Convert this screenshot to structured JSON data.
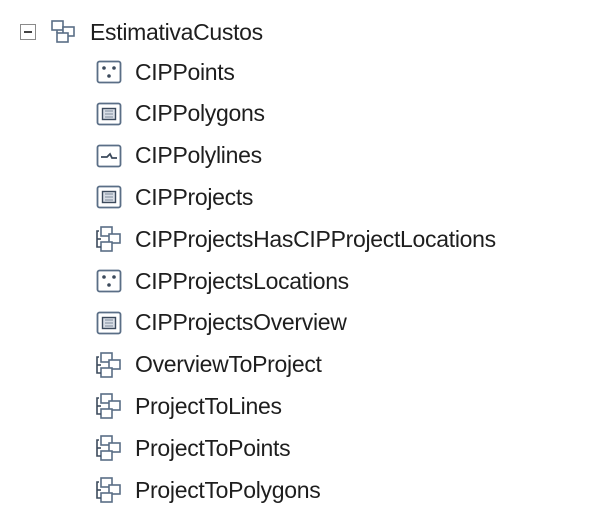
{
  "tree": {
    "root": {
      "label": "EstimativaCustos",
      "icon": "feature-dataset-icon",
      "expanded": true
    },
    "children": [
      {
        "label": "CIPPoints",
        "icon": "point-feature-class-icon"
      },
      {
        "label": "CIPPolygons",
        "icon": "polygon-feature-class-icon"
      },
      {
        "label": "CIPPolylines",
        "icon": "polyline-feature-class-icon"
      },
      {
        "label": "CIPProjects",
        "icon": "polygon-feature-class-icon"
      },
      {
        "label": "CIPProjectsHasCIPProjectLocations",
        "icon": "relationship-class-icon"
      },
      {
        "label": "CIPProjectsLocations",
        "icon": "point-feature-class-icon"
      },
      {
        "label": "CIPProjectsOverview",
        "icon": "polygon-feature-class-icon"
      },
      {
        "label": "OverviewToProject",
        "icon": "relationship-class-icon"
      },
      {
        "label": "ProjectToLines",
        "icon": "relationship-class-icon"
      },
      {
        "label": "ProjectToPoints",
        "icon": "relationship-class-icon"
      },
      {
        "label": "ProjectToPolygons",
        "icon": "relationship-class-icon"
      }
    ]
  }
}
